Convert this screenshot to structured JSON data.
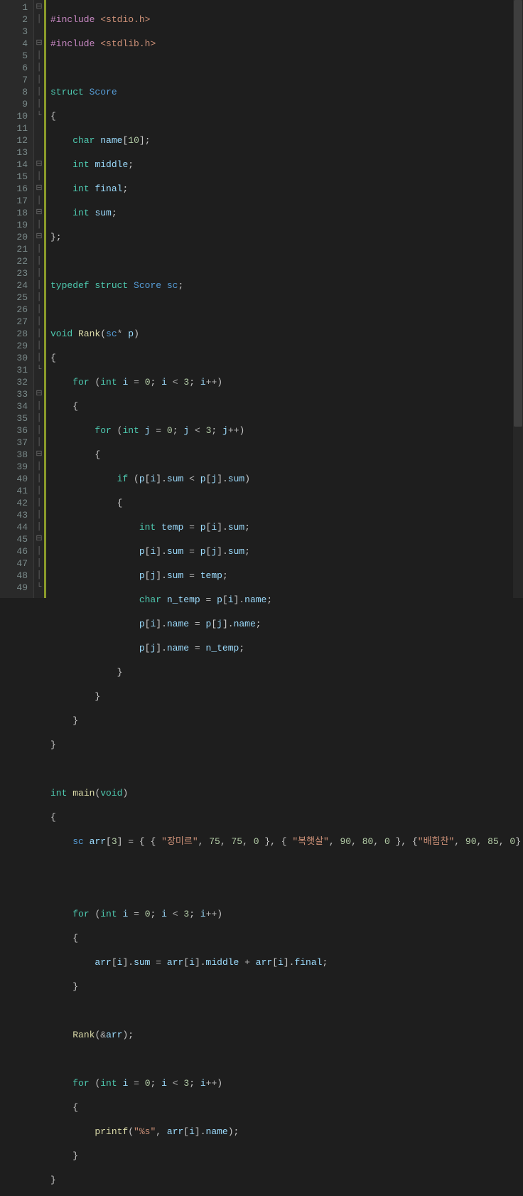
{
  "line_count": 49,
  "fold_markers": {
    "1": "⊟",
    "2": "│",
    "4": "⊟",
    "5": "│",
    "6": "│",
    "7": "│",
    "8": "│",
    "9": "│",
    "10": "└",
    "14": "⊟",
    "15": "│",
    "16": "⊟",
    "17": "│",
    "18": "⊟",
    "19": "│",
    "20": "⊟",
    "21": "│",
    "22": "│",
    "23": "│",
    "24": "│",
    "25": "│",
    "26": "│",
    "27": "│",
    "28": "│",
    "29": "│",
    "30": "│",
    "31": "└",
    "33": "⊟",
    "34": "│",
    "35": "│",
    "36": "│",
    "37": "│",
    "38": "⊟",
    "39": "│",
    "40": "│",
    "41": "│",
    "42": "│",
    "43": "│",
    "44": "│",
    "45": "⊟",
    "46": "│",
    "47": "│",
    "48": "│",
    "49": "└"
  },
  "tokens": {
    "include": "#include",
    "stdio": "<stdio.h>",
    "stdlib": "<stdlib.h>",
    "struct": "struct",
    "Score": "Score",
    "char": "char",
    "int": "int",
    "void": "void",
    "typedef": "typedef",
    "sc": "sc",
    "for": "for",
    "if": "if",
    "Rank": "Rank",
    "main": "main",
    "printf": "printf",
    "name_arr": "name",
    "ten": "10",
    "middle": "middle",
    "final": "final",
    "sum": "sum",
    "p": "p",
    "i": "i",
    "j": "j",
    "zero": "0",
    "three": "3",
    "temp": "temp",
    "n_temp": "n_temp",
    "arr": "arr",
    "arr3": "3",
    "s1": "\"장미르\"",
    "s2": "\"복햇살\"",
    "s3": "\"배힘찬\"",
    "n75": "75",
    "n90": "90",
    "n80": "80",
    "n85": "85",
    "fmt": "\"%s\"",
    "amp": "&"
  }
}
